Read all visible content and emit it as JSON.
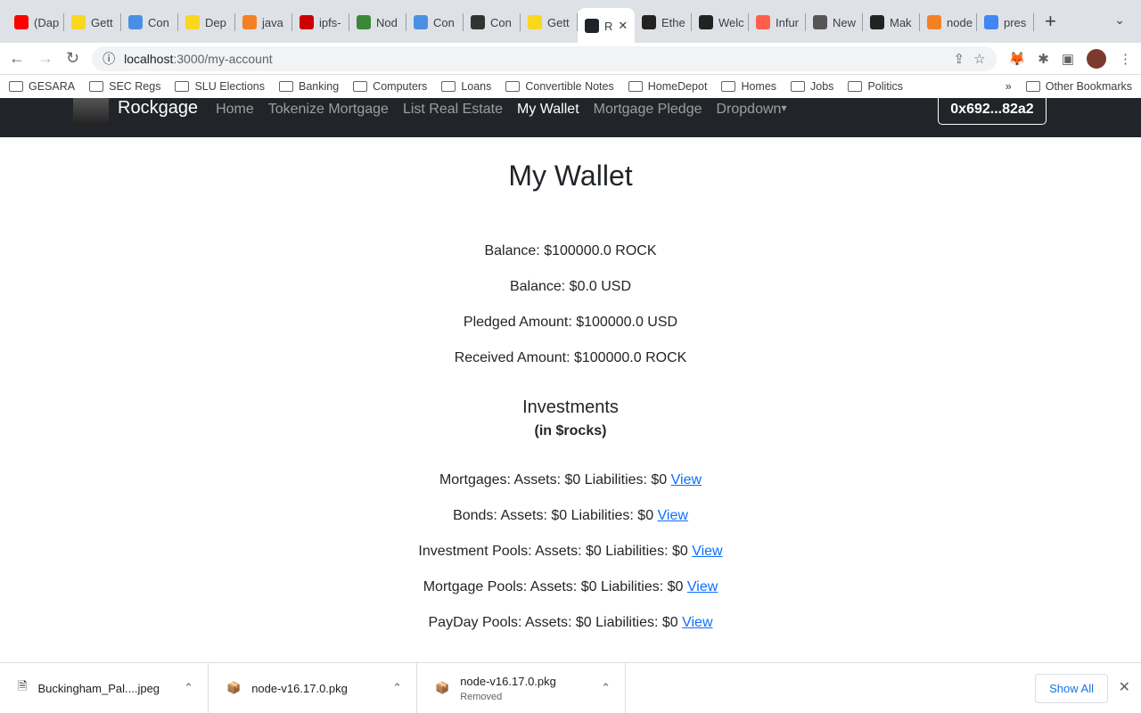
{
  "browser": {
    "tabs": [
      {
        "label": "(Dap",
        "icon": "youtube-icon",
        "color": "#ff0000"
      },
      {
        "label": "Gett",
        "icon": "warning-icon",
        "color": "#f9d71c"
      },
      {
        "label": "Con",
        "icon": "zenhub-icon",
        "color": "#4a90e2"
      },
      {
        "label": "Dep",
        "icon": "warning-icon",
        "color": "#f9d71c"
      },
      {
        "label": "java",
        "icon": "stackoverflow-icon",
        "color": "#f48024"
      },
      {
        "label": "ipfs-",
        "icon": "npm-icon",
        "color": "#cb0000"
      },
      {
        "label": "Nod",
        "icon": "nodejs-icon",
        "color": "#3c873a"
      },
      {
        "label": "Con",
        "icon": "zenhub-icon",
        "color": "#4a90e2"
      },
      {
        "label": "Con",
        "icon": "cloud-icon",
        "color": "#333333"
      },
      {
        "label": "Gett",
        "icon": "warning-icon",
        "color": "#f9d71c"
      },
      {
        "label": "R",
        "icon": "react-icon",
        "color": "#20232a",
        "active": true
      },
      {
        "label": "Ethe",
        "icon": "infura-icon",
        "color": "#222222"
      },
      {
        "label": "Welc",
        "icon": "infura-icon",
        "color": "#222222"
      },
      {
        "label": "Infur",
        "icon": "infura-icon",
        "color": "#ff5e4d"
      },
      {
        "label": "New",
        "icon": "chrome-icon",
        "color": "#555555"
      },
      {
        "label": "Mak",
        "icon": "infura-icon",
        "color": "#222222"
      },
      {
        "label": "node",
        "icon": "stackoverflow-icon",
        "color": "#f48024"
      },
      {
        "label": "pres",
        "icon": "google-icon",
        "color": "#4285f4"
      }
    ],
    "url_host": "localhost",
    "url_path": ":3000/my-account",
    "bookmarks": [
      "GESARA",
      "SEC Regs",
      "SLU Elections",
      "Banking",
      "Computers",
      "Loans",
      "Convertible Notes",
      "HomeDepot",
      "Homes",
      "Jobs",
      "Politics"
    ],
    "other_bookmarks": "Other Bookmarks"
  },
  "navbar": {
    "brand": "Rockgage",
    "links": [
      "Home",
      "Tokenize Mortgage",
      "List Real Estate",
      "My Wallet",
      "Mortgage Pledge",
      "Dropdown"
    ],
    "active": "My Wallet",
    "wallet": "0x692...82a2"
  },
  "main": {
    "title": "My Wallet",
    "balances": [
      "Balance: $100000.0 ROCK",
      "Balance: $0.0 USD",
      "Pledged Amount: $100000.0 USD",
      "Received Amount: $100000.0 ROCK"
    ],
    "investments_title": "Investments",
    "investments_sub": "(in $rocks)",
    "investments": [
      {
        "text": "Mortgages: Assets: $0 Liabilities: $0",
        "link": "View"
      },
      {
        "text": "Bonds: Assets: $0 Liabilities: $0",
        "link": "View"
      },
      {
        "text": "Investment Pools: Assets: $0 Liabilities: $0",
        "link": "View"
      },
      {
        "text": "Mortgage Pools: Assets: $0 Liabilities: $0",
        "link": "View"
      },
      {
        "text": "PayDay Pools: Assets: $0 Liabilities: $0",
        "link": "View"
      }
    ]
  },
  "downloads": {
    "items": [
      {
        "name": "Buckingham_Pal....jpeg",
        "status": ""
      },
      {
        "name": "node-v16.17.0.pkg",
        "status": ""
      },
      {
        "name": "node-v16.17.0.pkg",
        "status": "Removed"
      }
    ],
    "show_all": "Show All"
  }
}
